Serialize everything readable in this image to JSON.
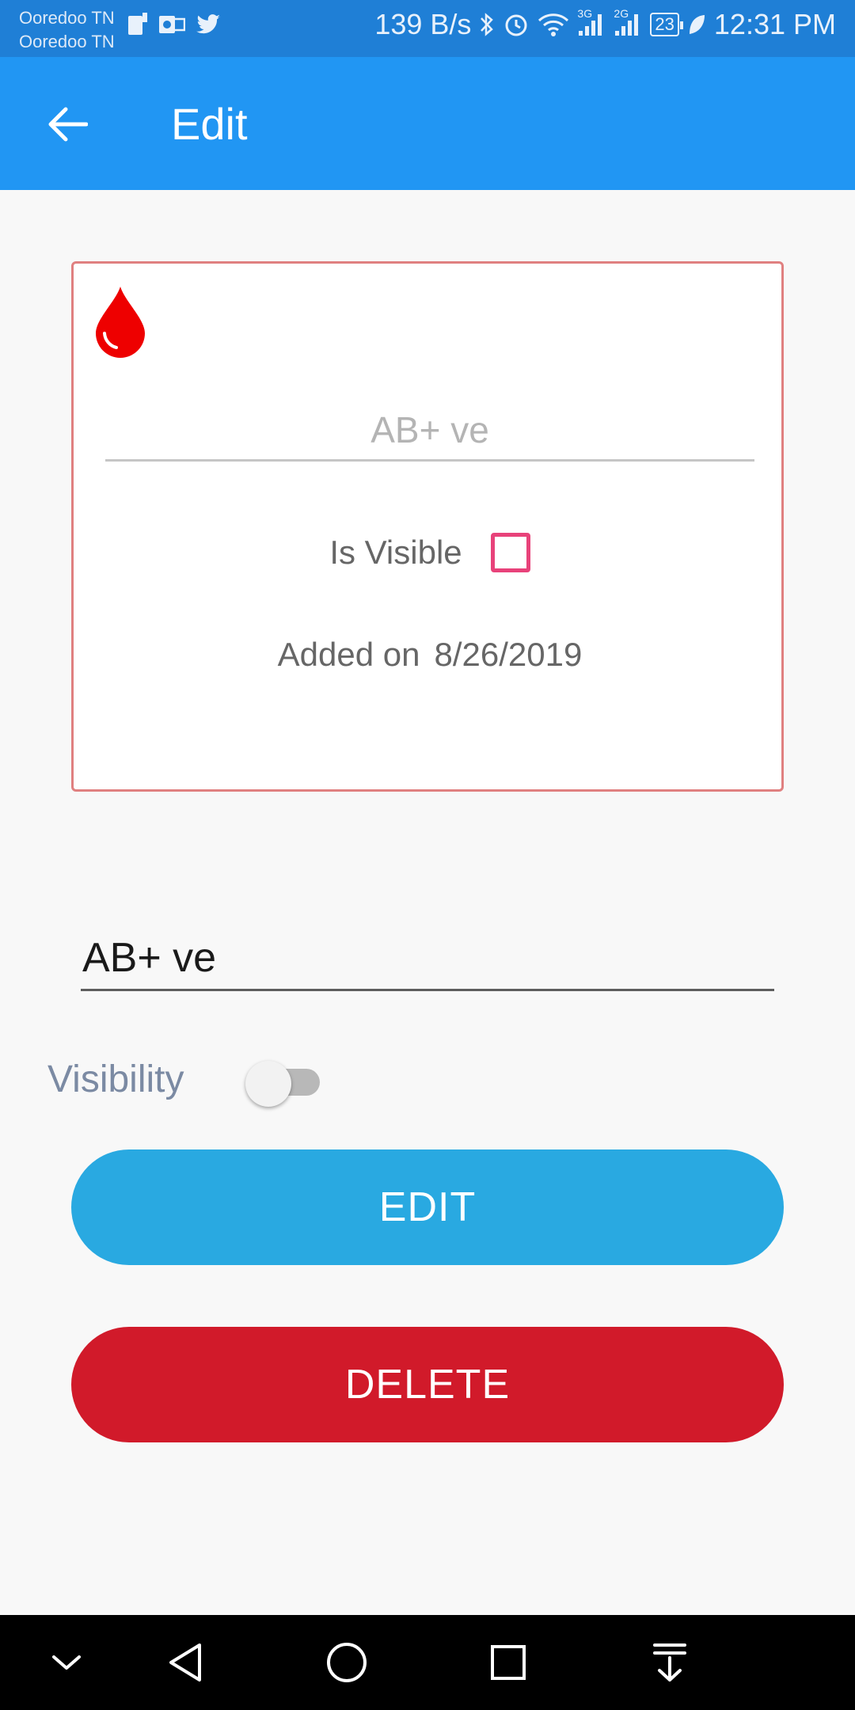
{
  "status_bar": {
    "carrier_1": "Ooredoo TN",
    "carrier_2": "Ooredoo TN",
    "net_speed": "139 B/s",
    "network_1": "3G",
    "network_2": "2G",
    "battery": "23",
    "time": "12:31 PM"
  },
  "app_bar": {
    "title": "Edit",
    "back_icon": "arrow-back-icon"
  },
  "card": {
    "icon": "blood-drop-icon",
    "blood_type": "AB+ ve",
    "visible_label": "Is Visible",
    "visible_checked": false,
    "added_label": "Added on",
    "added_date": "8/26/2019"
  },
  "form": {
    "blood_type_value": "AB+ ve",
    "visibility_label": "Visibility",
    "visibility_on": false
  },
  "buttons": {
    "edit_label": "EDIT",
    "delete_label": "DELETE"
  },
  "colors": {
    "app_bar": "#2196f3",
    "status_bar": "#1f7fd6",
    "edit_button": "#29a9e1",
    "delete_button": "#d11a2a",
    "card_border": "#e08080",
    "checkbox": "#e8427a",
    "drop": "#ee0000"
  },
  "nav_bar": {
    "icons": [
      "chevron-down-icon",
      "back-triangle-icon",
      "home-circle-icon",
      "recents-square-icon",
      "notification-pull-icon"
    ]
  }
}
